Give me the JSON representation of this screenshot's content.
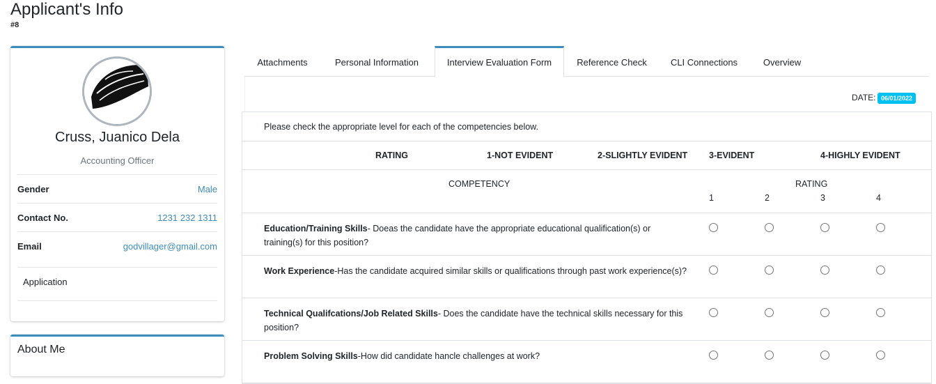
{
  "header": {
    "title": "Applicant's Info",
    "subtitle": "#8"
  },
  "profile": {
    "name": "Cruss, Juanico Dela",
    "position": "Accounting Officer",
    "fields": [
      {
        "label": "Gender",
        "value": "Male"
      },
      {
        "label": "Contact No.",
        "value": "1231 232 1311"
      },
      {
        "label": "Email",
        "value": "godvillager@gmail.com"
      }
    ],
    "application_label": "Application"
  },
  "about": {
    "title": "About Me"
  },
  "tabs": [
    {
      "label": "Attachments"
    },
    {
      "label": "Personal Information"
    },
    {
      "label": "Interview Evaluation Form",
      "active": true
    },
    {
      "label": "Reference Check"
    },
    {
      "label": "CLI Connections"
    },
    {
      "label": "Overview"
    }
  ],
  "form": {
    "date_label": "DATE:",
    "date_value": "06/01/2022",
    "instructions": "Please check the appropriate level for each of the competencies below.",
    "scale": {
      "rating": "RATING",
      "level1": "1-NOT EVIDENT",
      "level2": "2-SLIGHTLY EVIDENT",
      "level3": "3-EVIDENT",
      "level4": "4-HIGHLY EVIDENT"
    },
    "columns": {
      "competency": "COMPETENCY",
      "rating": "RATING",
      "r1": "1",
      "r2": "2",
      "r3": "3",
      "r4": "4"
    },
    "questions": [
      {
        "title": "Education/Training Skills",
        "text": "- Doeas the candidate have the appropriate educational qualification(s) or training(s) for this position?"
      },
      {
        "title": "Work Experience",
        "text": "-Has the candidate acquired similar skills or qualifications through past work experience(s)?"
      },
      {
        "title": "Technical Qualifcations/Job Related Skills",
        "text": "- Does the candidate have the technical skills necessary for this position?"
      },
      {
        "title": "Problem Solving Skills",
        "text": "-How did candidate hancle challenges at work?"
      }
    ]
  },
  "colors": {
    "accent": "#3c8dbc",
    "badge": "#00c0ef"
  }
}
